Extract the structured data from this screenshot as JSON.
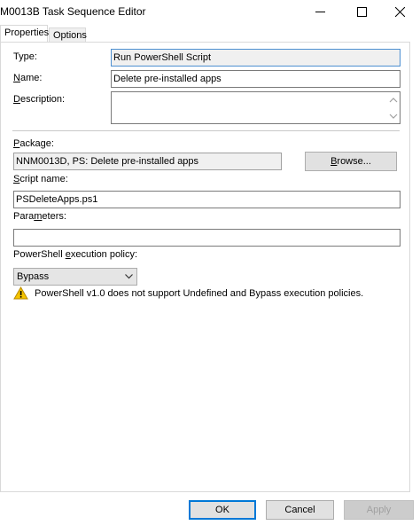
{
  "window": {
    "title": "M0013B Task Sequence Editor",
    "controls": {
      "minimize_icon": "minimize-icon",
      "maximize_icon": "maximize-icon",
      "close_icon": "close-icon"
    }
  },
  "tabs": [
    {
      "label": "Properties",
      "active": true
    },
    {
      "label": "Options",
      "active": false
    }
  ],
  "form": {
    "type_label": "Type:",
    "type_value": "Run PowerShell Script",
    "name_label": "Name:",
    "name_value": "Delete pre-installed apps",
    "description_label": "Description:",
    "description_value": "",
    "package_label": "Package:",
    "package_value": "NNM0013D, PS: Delete pre-installed apps",
    "browse_label": "Browse...",
    "script_name_label": "Script name:",
    "script_name_value": "PSDeleteApps.ps1",
    "parameters_label": "Parameters:",
    "parameters_value": "",
    "policy_label": "PowerShell execution policy:",
    "policy_value": "Bypass",
    "warning_icon": "warning-icon",
    "warning_text": "PowerShell v1.0 does not support Undefined and Bypass execution policies."
  },
  "footer": {
    "ok_label": "OK",
    "cancel_label": "Cancel",
    "apply_label": "Apply"
  }
}
